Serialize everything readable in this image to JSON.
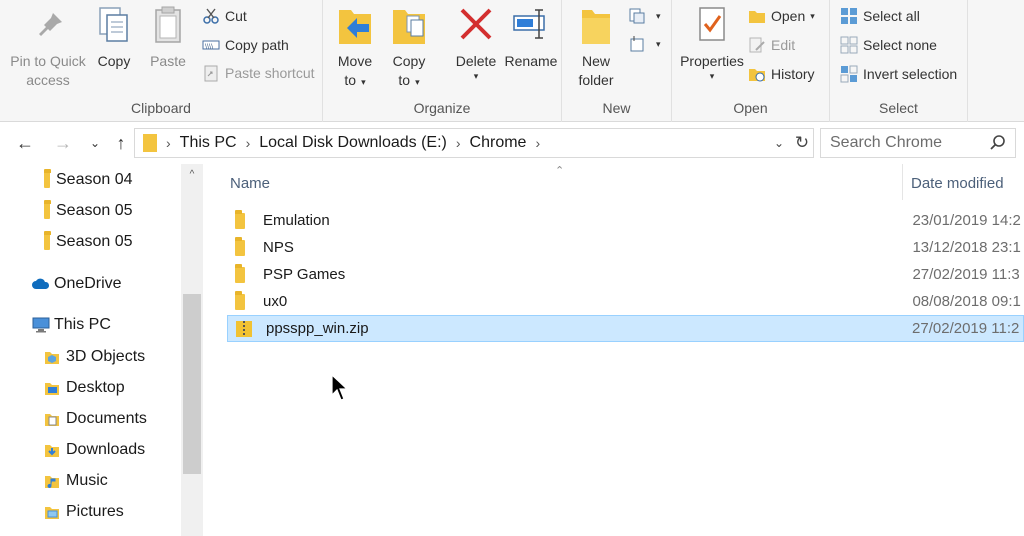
{
  "ribbon": {
    "clipboard": {
      "label": "Clipboard",
      "pin_line1": "Pin to Quick",
      "pin_line2": "access",
      "copy": "Copy",
      "paste": "Paste",
      "cut": "Cut",
      "copy_path": "Copy path",
      "paste_shortcut": "Paste shortcut"
    },
    "organize": {
      "label": "Organize",
      "move_line1": "Move",
      "move_line2": "to",
      "copy_line1": "Copy",
      "copy_line2": "to",
      "delete": "Delete",
      "rename": "Rename"
    },
    "new": {
      "label": "New",
      "folder_line1": "New",
      "folder_line2": "folder"
    },
    "open": {
      "label": "Open",
      "properties": "Properties",
      "open": "Open",
      "edit": "Edit",
      "history": "History"
    },
    "select": {
      "label": "Select",
      "select_all": "Select all",
      "select_none": "Select none",
      "invert": "Invert selection"
    }
  },
  "address": {
    "crumbs": [
      "This PC",
      "Local Disk Downloads (E:)",
      "Chrome"
    ],
    "search_placeholder": "Search Chrome"
  },
  "navpane": {
    "items": [
      "Season 04",
      "Season 05",
      "Season 05",
      "OneDrive",
      "This PC",
      "3D Objects",
      "Desktop",
      "Documents",
      "Downloads",
      "Music",
      "Pictures"
    ]
  },
  "filelist": {
    "columns": {
      "name": "Name",
      "date": "Date modified"
    },
    "rows": [
      {
        "name": "Emulation",
        "date": "23/01/2019 14:2",
        "type": "folder"
      },
      {
        "name": "NPS",
        "date": "13/12/2018 23:1",
        "type": "folder"
      },
      {
        "name": "PSP Games",
        "date": "27/02/2019 11:3",
        "type": "folder"
      },
      {
        "name": "ux0",
        "date": "08/08/2018 09:1",
        "type": "folder"
      },
      {
        "name": "ppsspp_win.zip",
        "date": "27/02/2019 11:2",
        "type": "zip"
      }
    ]
  },
  "colors": {
    "selection": "#cce8ff",
    "folder": "#f3c43f",
    "accent": "#0078d7"
  }
}
